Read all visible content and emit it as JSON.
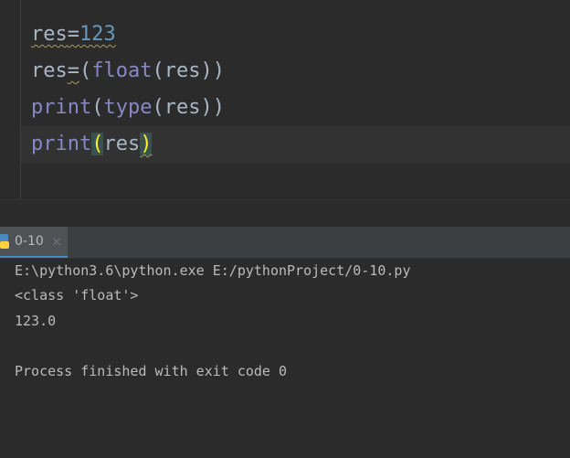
{
  "editor": {
    "lines": [
      {
        "tokens": [
          "res",
          "=",
          "123"
        ]
      },
      {
        "tokens": [
          "res",
          "=",
          "(",
          "float",
          "(",
          "res",
          "))"
        ]
      },
      {
        "tokens": [
          "print",
          "(",
          "type",
          "(",
          "res",
          "))"
        ]
      },
      {
        "tokens": [
          "print",
          "(",
          "res",
          ")"
        ]
      }
    ]
  },
  "run_tab": {
    "label": "0-10",
    "close_glyph": "×",
    "icon": "python-icon"
  },
  "console": {
    "lines": [
      "E:\\python3.6\\python.exe E:/pythonProject/0-10.py",
      "<class 'float'>",
      "123.0",
      "",
      "Process finished with exit code 0"
    ]
  },
  "colors": {
    "background": "#2b2b2b",
    "identifier": "#a9b7c6",
    "number": "#6897bb",
    "builtin": "#8888c6",
    "brace_match": "#ffef28",
    "tab_accent": "#4a88c7"
  }
}
